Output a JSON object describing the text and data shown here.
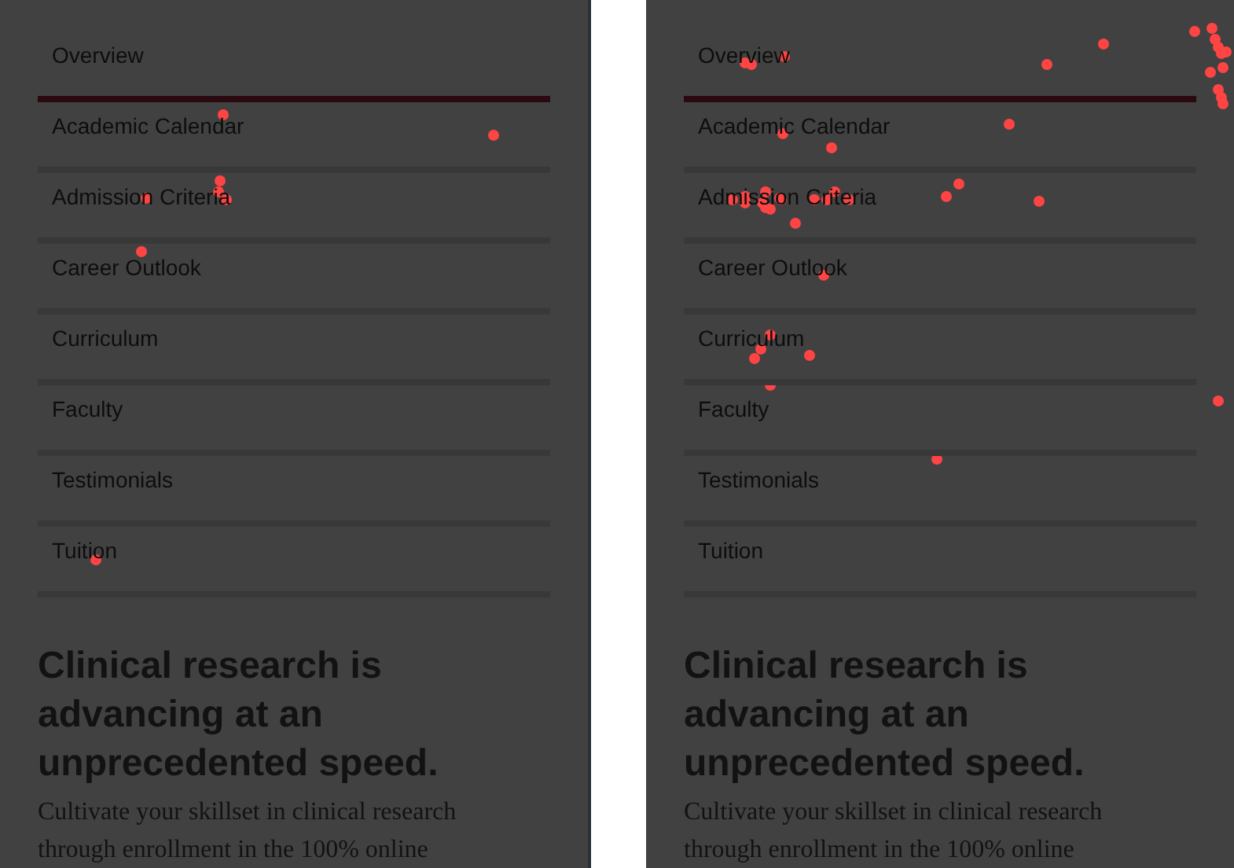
{
  "panels": [
    {
      "nav_items": [
        {
          "label": "Overview",
          "selected": true
        },
        {
          "label": "Academic Calendar",
          "selected": false
        },
        {
          "label": "Admission Criteria",
          "selected": false
        },
        {
          "label": "Career Outlook",
          "selected": false
        },
        {
          "label": "Curriculum",
          "selected": false
        },
        {
          "label": "Faculty",
          "selected": false
        },
        {
          "label": "Testimonials",
          "selected": false
        },
        {
          "label": "Tuition",
          "selected": false
        }
      ],
      "heading": "Clinical research is advancing at an unprecedented speed.",
      "paragraph": "Cultivate your skillset in clinical research through enrollment in the 100% online"
    },
    {
      "nav_items": [
        {
          "label": "Overview",
          "selected": true
        },
        {
          "label": "Academic Calendar",
          "selected": false
        },
        {
          "label": "Admission Criteria",
          "selected": false
        },
        {
          "label": "Career Outlook",
          "selected": false
        },
        {
          "label": "Curriculum",
          "selected": false
        },
        {
          "label": "Faculty",
          "selected": false
        },
        {
          "label": "Testimonials",
          "selected": false
        },
        {
          "label": "Tuition",
          "selected": false
        }
      ],
      "heading": "Clinical research is advancing at an unprecedented speed.",
      "paragraph": "Cultivate your skillset in clinical research through enrollment in the 100% online"
    }
  ]
}
